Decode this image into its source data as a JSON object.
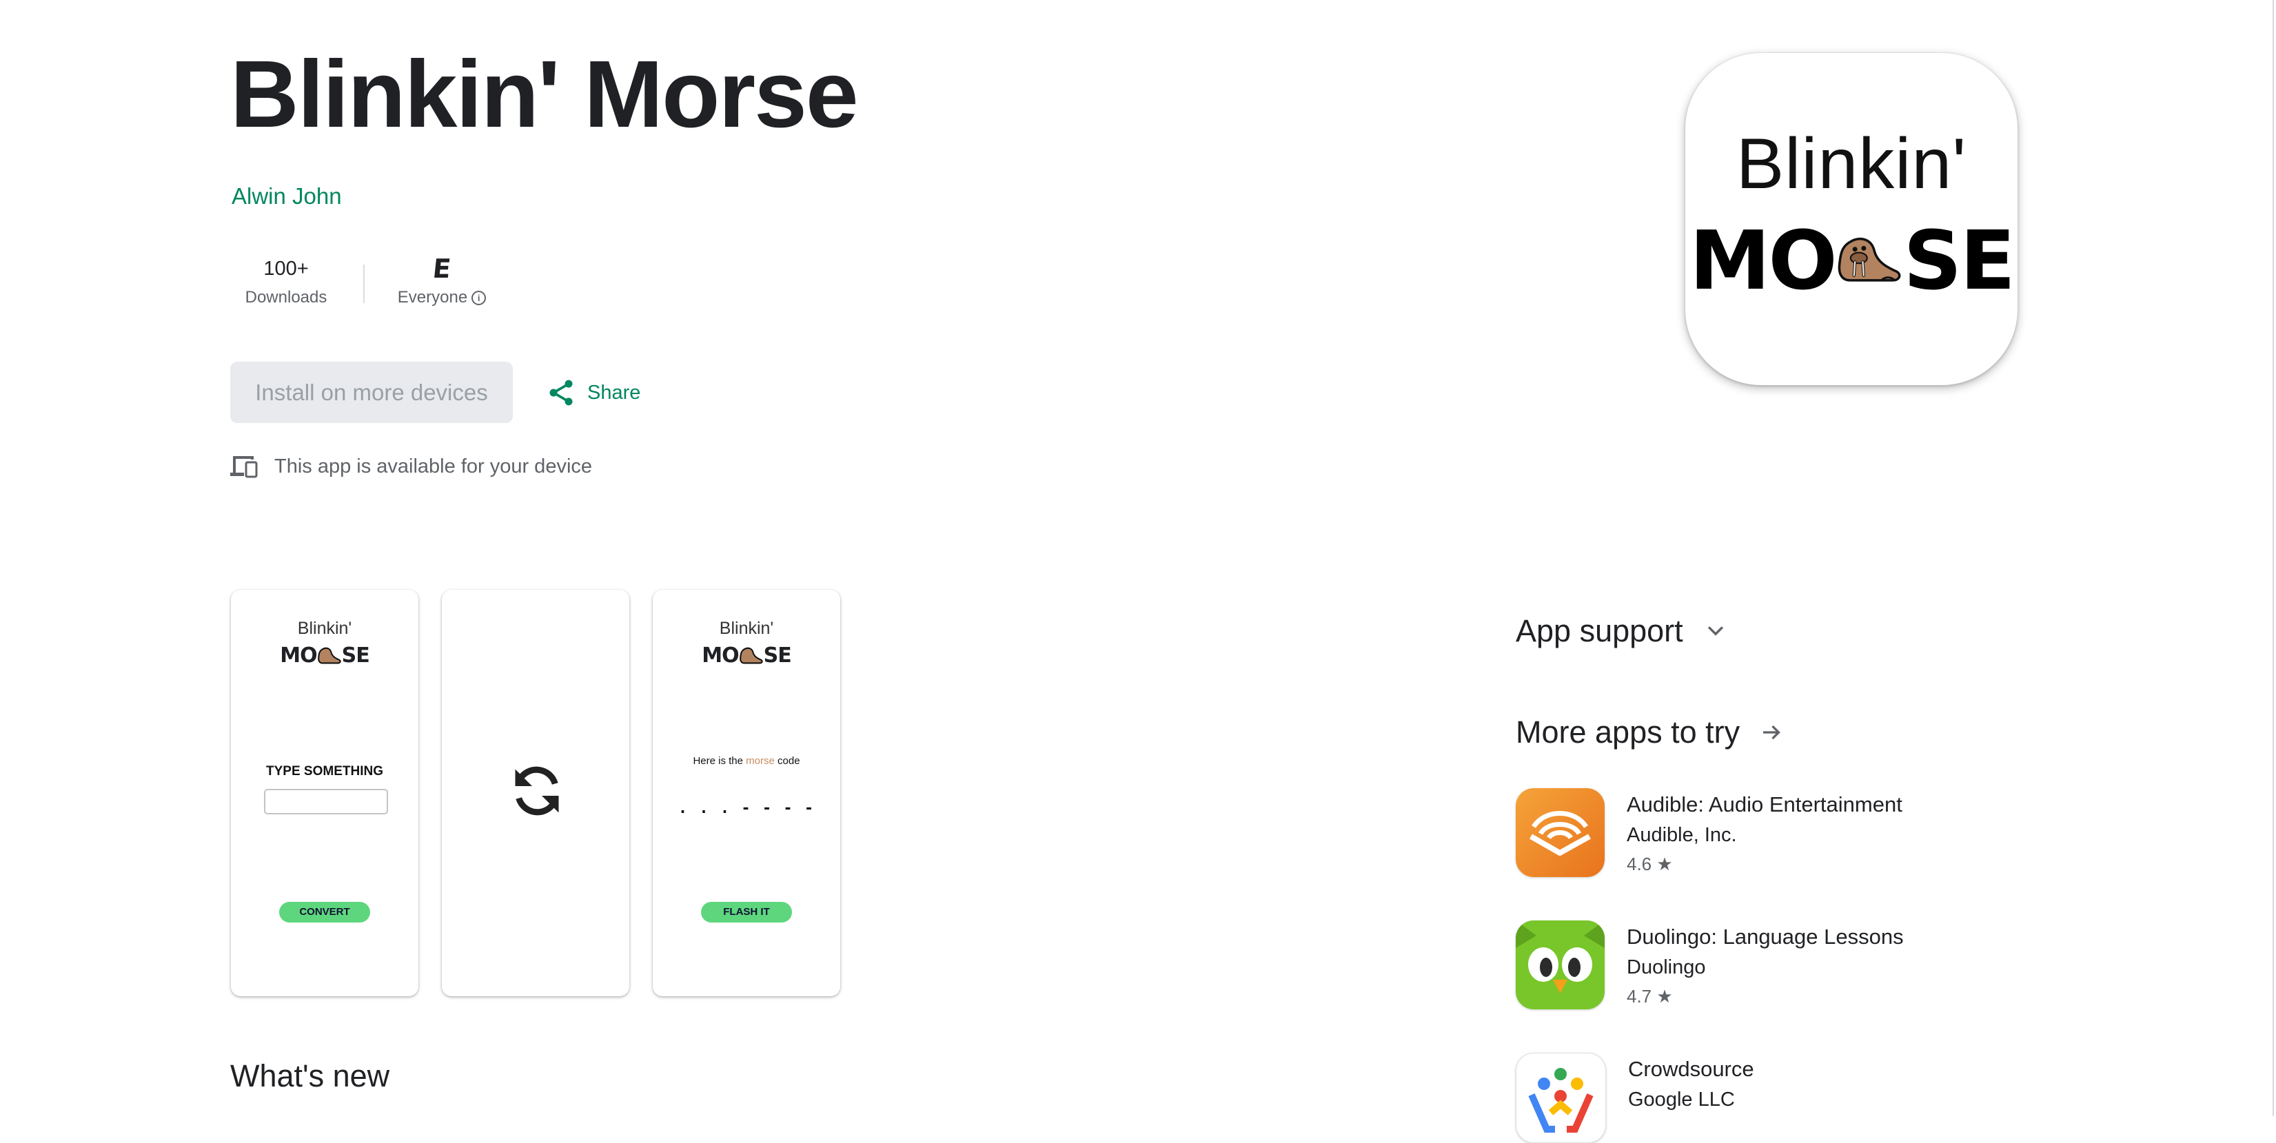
{
  "app": {
    "title": "Blinkin' Morse",
    "developer": "Alwin John",
    "icon_text_line1": "Blinkin'",
    "icon_text_line2_left": "MO",
    "icon_text_line2_right": "SE"
  },
  "stats": {
    "downloads_value": "100+",
    "downloads_label": "Downloads",
    "rating_badge": "E",
    "rating_label": "Everyone"
  },
  "actions": {
    "install_label": "Install on more devices",
    "share_label": "Share"
  },
  "availability": "This app is available for your device",
  "screenshots": {
    "shot1": {
      "blinkin": "Blinkin'",
      "morse_left": "MO",
      "morse_right": "SE",
      "prompt": "TYPE SOMETHING",
      "button": "CONVERT"
    },
    "shot3": {
      "blinkin": "Blinkin'",
      "morse_left": "MO",
      "morse_right": "SE",
      "text_before": "Here is the ",
      "text_highlight": "morse",
      "text_after": " code",
      "code": ". . .  - - - -",
      "button": "FLASH IT"
    }
  },
  "sections": {
    "whats_new": "What's new",
    "app_support": "App support",
    "more_apps": "More apps to try"
  },
  "recommendations": [
    {
      "name": "Audible: Audio Entertainment",
      "developer": "Audible, Inc.",
      "rating": "4.6",
      "icon": "audible-icon"
    },
    {
      "name": "Duolingo: Language Lessons",
      "developer": "Duolingo",
      "rating": "4.7",
      "icon": "duolingo-owl-icon"
    },
    {
      "name": "Crowdsource",
      "developer": "Google LLC",
      "rating": "",
      "icon": "crowdsource-icon"
    }
  ],
  "colors": {
    "accent_green": "#01875f",
    "disabled_button_bg": "#e8eaed",
    "app_button_green": "#5ed67e",
    "walrus_brown": "#b38360"
  }
}
